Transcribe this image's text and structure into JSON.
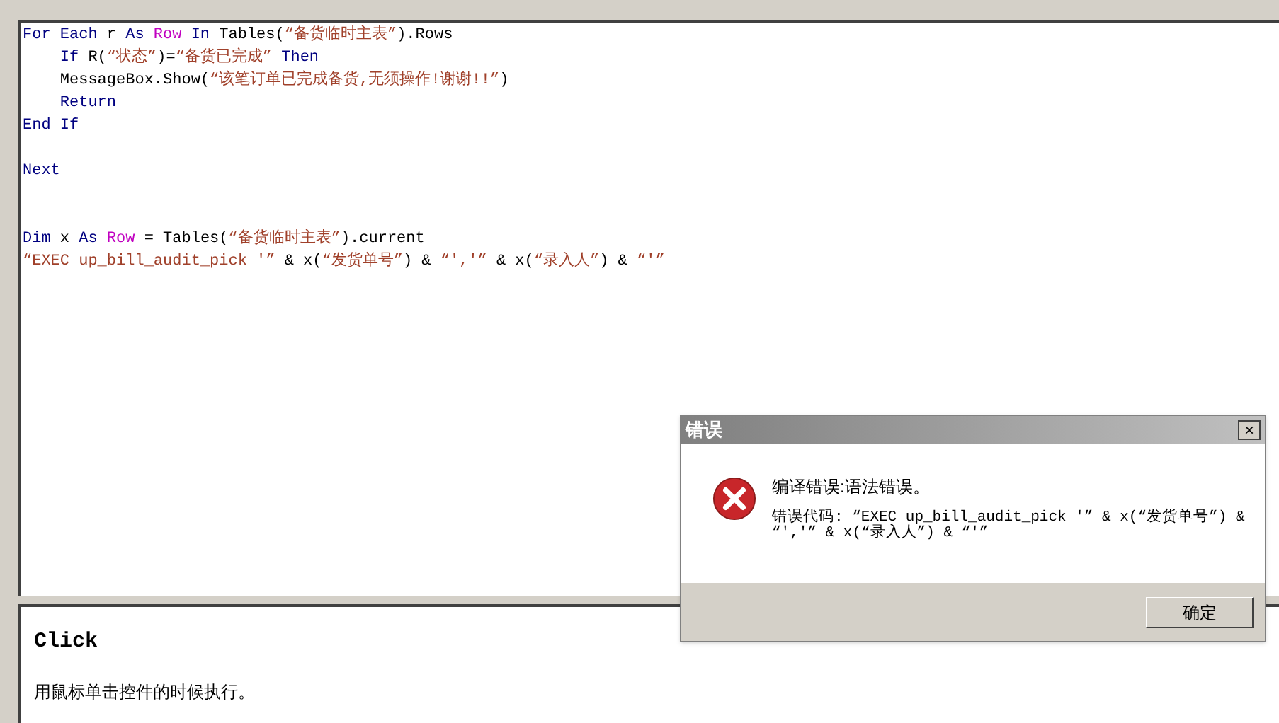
{
  "editor": {
    "lines": [
      {
        "kind": "code",
        "tokens": [
          {
            "text": "For Each",
            "kind": "keyword"
          },
          {
            "text": " r ",
            "kind": "plain"
          },
          {
            "text": "As",
            "kind": "keyword"
          },
          {
            "text": " Row",
            "kind": "type"
          },
          {
            "text": " In",
            "kind": "keyword"
          },
          {
            "text": " Tables(",
            "kind": "plain"
          },
          {
            "text": "“备货临时主表”",
            "kind": "string"
          },
          {
            "text": ").Rows",
            "kind": "plain"
          }
        ]
      },
      {
        "kind": "code",
        "tokens": [
          {
            "text": "    If",
            "kind": "keyword"
          },
          {
            "text": " R(",
            "kind": "plain"
          },
          {
            "text": "“状态”",
            "kind": "string"
          },
          {
            "text": ")=",
            "kind": "plain"
          },
          {
            "text": "“备货已完成”",
            "kind": "string"
          },
          {
            "text": " Then",
            "kind": "keyword"
          }
        ]
      },
      {
        "kind": "code",
        "tokens": [
          {
            "text": "    MessageBox.Show(",
            "kind": "plain"
          },
          {
            "text": "“该笔订单已完成备货,无须操作!谢谢!!”",
            "kind": "string"
          },
          {
            "text": ")",
            "kind": "plain"
          }
        ]
      },
      {
        "kind": "code",
        "tokens": [
          {
            "text": "    Return",
            "kind": "keyword"
          }
        ]
      },
      {
        "kind": "code",
        "tokens": [
          {
            "text": "End If",
            "kind": "keyword"
          }
        ]
      },
      {
        "kind": "blank"
      },
      {
        "kind": "code",
        "tokens": [
          {
            "text": "Next",
            "kind": "keyword"
          }
        ]
      },
      {
        "kind": "blank"
      },
      {
        "kind": "blank"
      },
      {
        "kind": "code",
        "tokens": [
          {
            "text": "Dim",
            "kind": "keyword"
          },
          {
            "text": " x ",
            "kind": "plain"
          },
          {
            "text": "As",
            "kind": "keyword"
          },
          {
            "text": " Row",
            "kind": "type"
          },
          {
            "text": " = Tables(",
            "kind": "plain"
          },
          {
            "text": "“备货临时主表”",
            "kind": "string"
          },
          {
            "text": ").current",
            "kind": "plain"
          }
        ]
      },
      {
        "kind": "code",
        "tokens": [
          {
            "text": "“EXEC up_bill_audit_pick '”",
            "kind": "string"
          },
          {
            "text": " & x(",
            "kind": "plain"
          },
          {
            "text": "“发货单号”",
            "kind": "string"
          },
          {
            "text": ") & ",
            "kind": "plain"
          },
          {
            "text": "“','”",
            "kind": "string"
          },
          {
            "text": " & x(",
            "kind": "plain"
          },
          {
            "text": "“录入人”",
            "kind": "string"
          },
          {
            "text": ") & ",
            "kind": "plain"
          },
          {
            "text": "“'”",
            "kind": "string"
          }
        ]
      }
    ]
  },
  "help": {
    "title": "Click",
    "description": "用鼠标单击控件的时候执行。"
  },
  "dialog": {
    "title": "错误",
    "close": "×",
    "message": "编译错误:语法错误。",
    "detail": "错误代码: “EXEC up_bill_audit_pick '” & x(“发货单号”) & “','” & x(“录入人”) & “'”",
    "button": "确定"
  }
}
